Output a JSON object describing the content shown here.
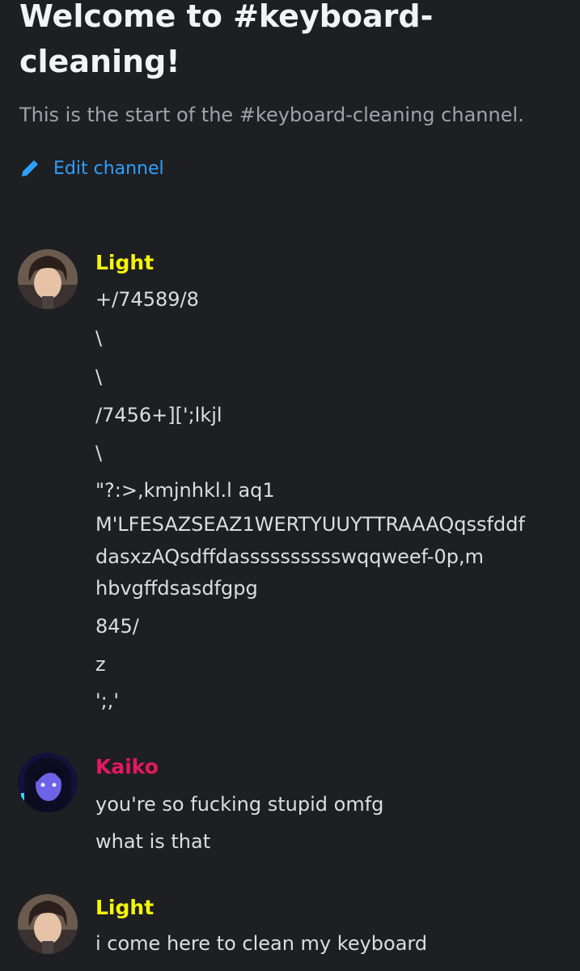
{
  "header": {
    "title": "Welcome to #keyboard-\ncleaning!",
    "subtitle": "This is the start of the #keyboard-cleaning channel.",
    "edit_label": "Edit channel",
    "edit_icon": "pencil-icon"
  },
  "colors": {
    "background": "#1e1f22",
    "link": "#2ea0ff",
    "light_name": "#f5f50c",
    "kaiko_name": "#e3195d"
  },
  "messages": [
    {
      "author": "Light",
      "lines": [
        "+/74589/8",
        "\\",
        "\\",
        "/7456+][';lkjl",
        "\\",
        "\"?:>,kmjnhkl.l  aq1",
        "M'LFESAZSEAZ1WERTYUUYTTRAAAQqssfddf",
        "dasxzAQsdffdasssssssssswqqweef-0p,m",
        "hbvgffdsasdfgpg",
        "845/",
        "z",
        "';,'"
      ]
    },
    {
      "author": "Kaiko",
      "lines": [
        "you're so fucking stupid omfg",
        "what is that"
      ]
    },
    {
      "author": "Light",
      "lines": [
        "i come here to clean my keyboard"
      ]
    }
  ]
}
